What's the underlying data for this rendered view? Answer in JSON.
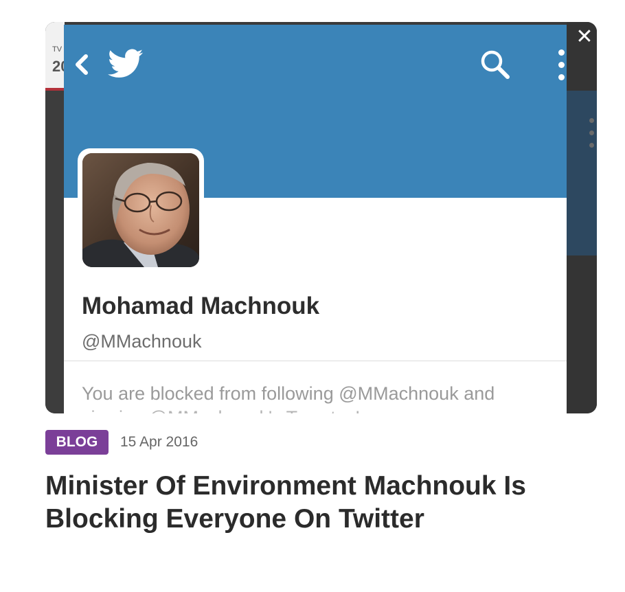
{
  "card": {
    "close_icon": "close-icon",
    "close_glyph": "✕",
    "background_tab": {
      "line1": "TV",
      "line2": "20"
    }
  },
  "twitter": {
    "header_color": "#3b84b8",
    "icons": [
      "back-chevron-icon",
      "twitter-bird-icon",
      "search-icon",
      "more-vertical-icon"
    ],
    "profile": {
      "name": "Mohamad Machnouk",
      "handle": "@MMachnouk"
    },
    "blocked_message": "You are blocked from following @MMachnouk and",
    "blocked_message_cont": "viewing @MMachnouk's Tweets. Learn more"
  },
  "post": {
    "category": "BLOG",
    "category_color": "#7b3f98",
    "date": "15 Apr 2016",
    "title": "Minister Of Environment Machnouk Is Blocking Everyone On Twitter"
  }
}
